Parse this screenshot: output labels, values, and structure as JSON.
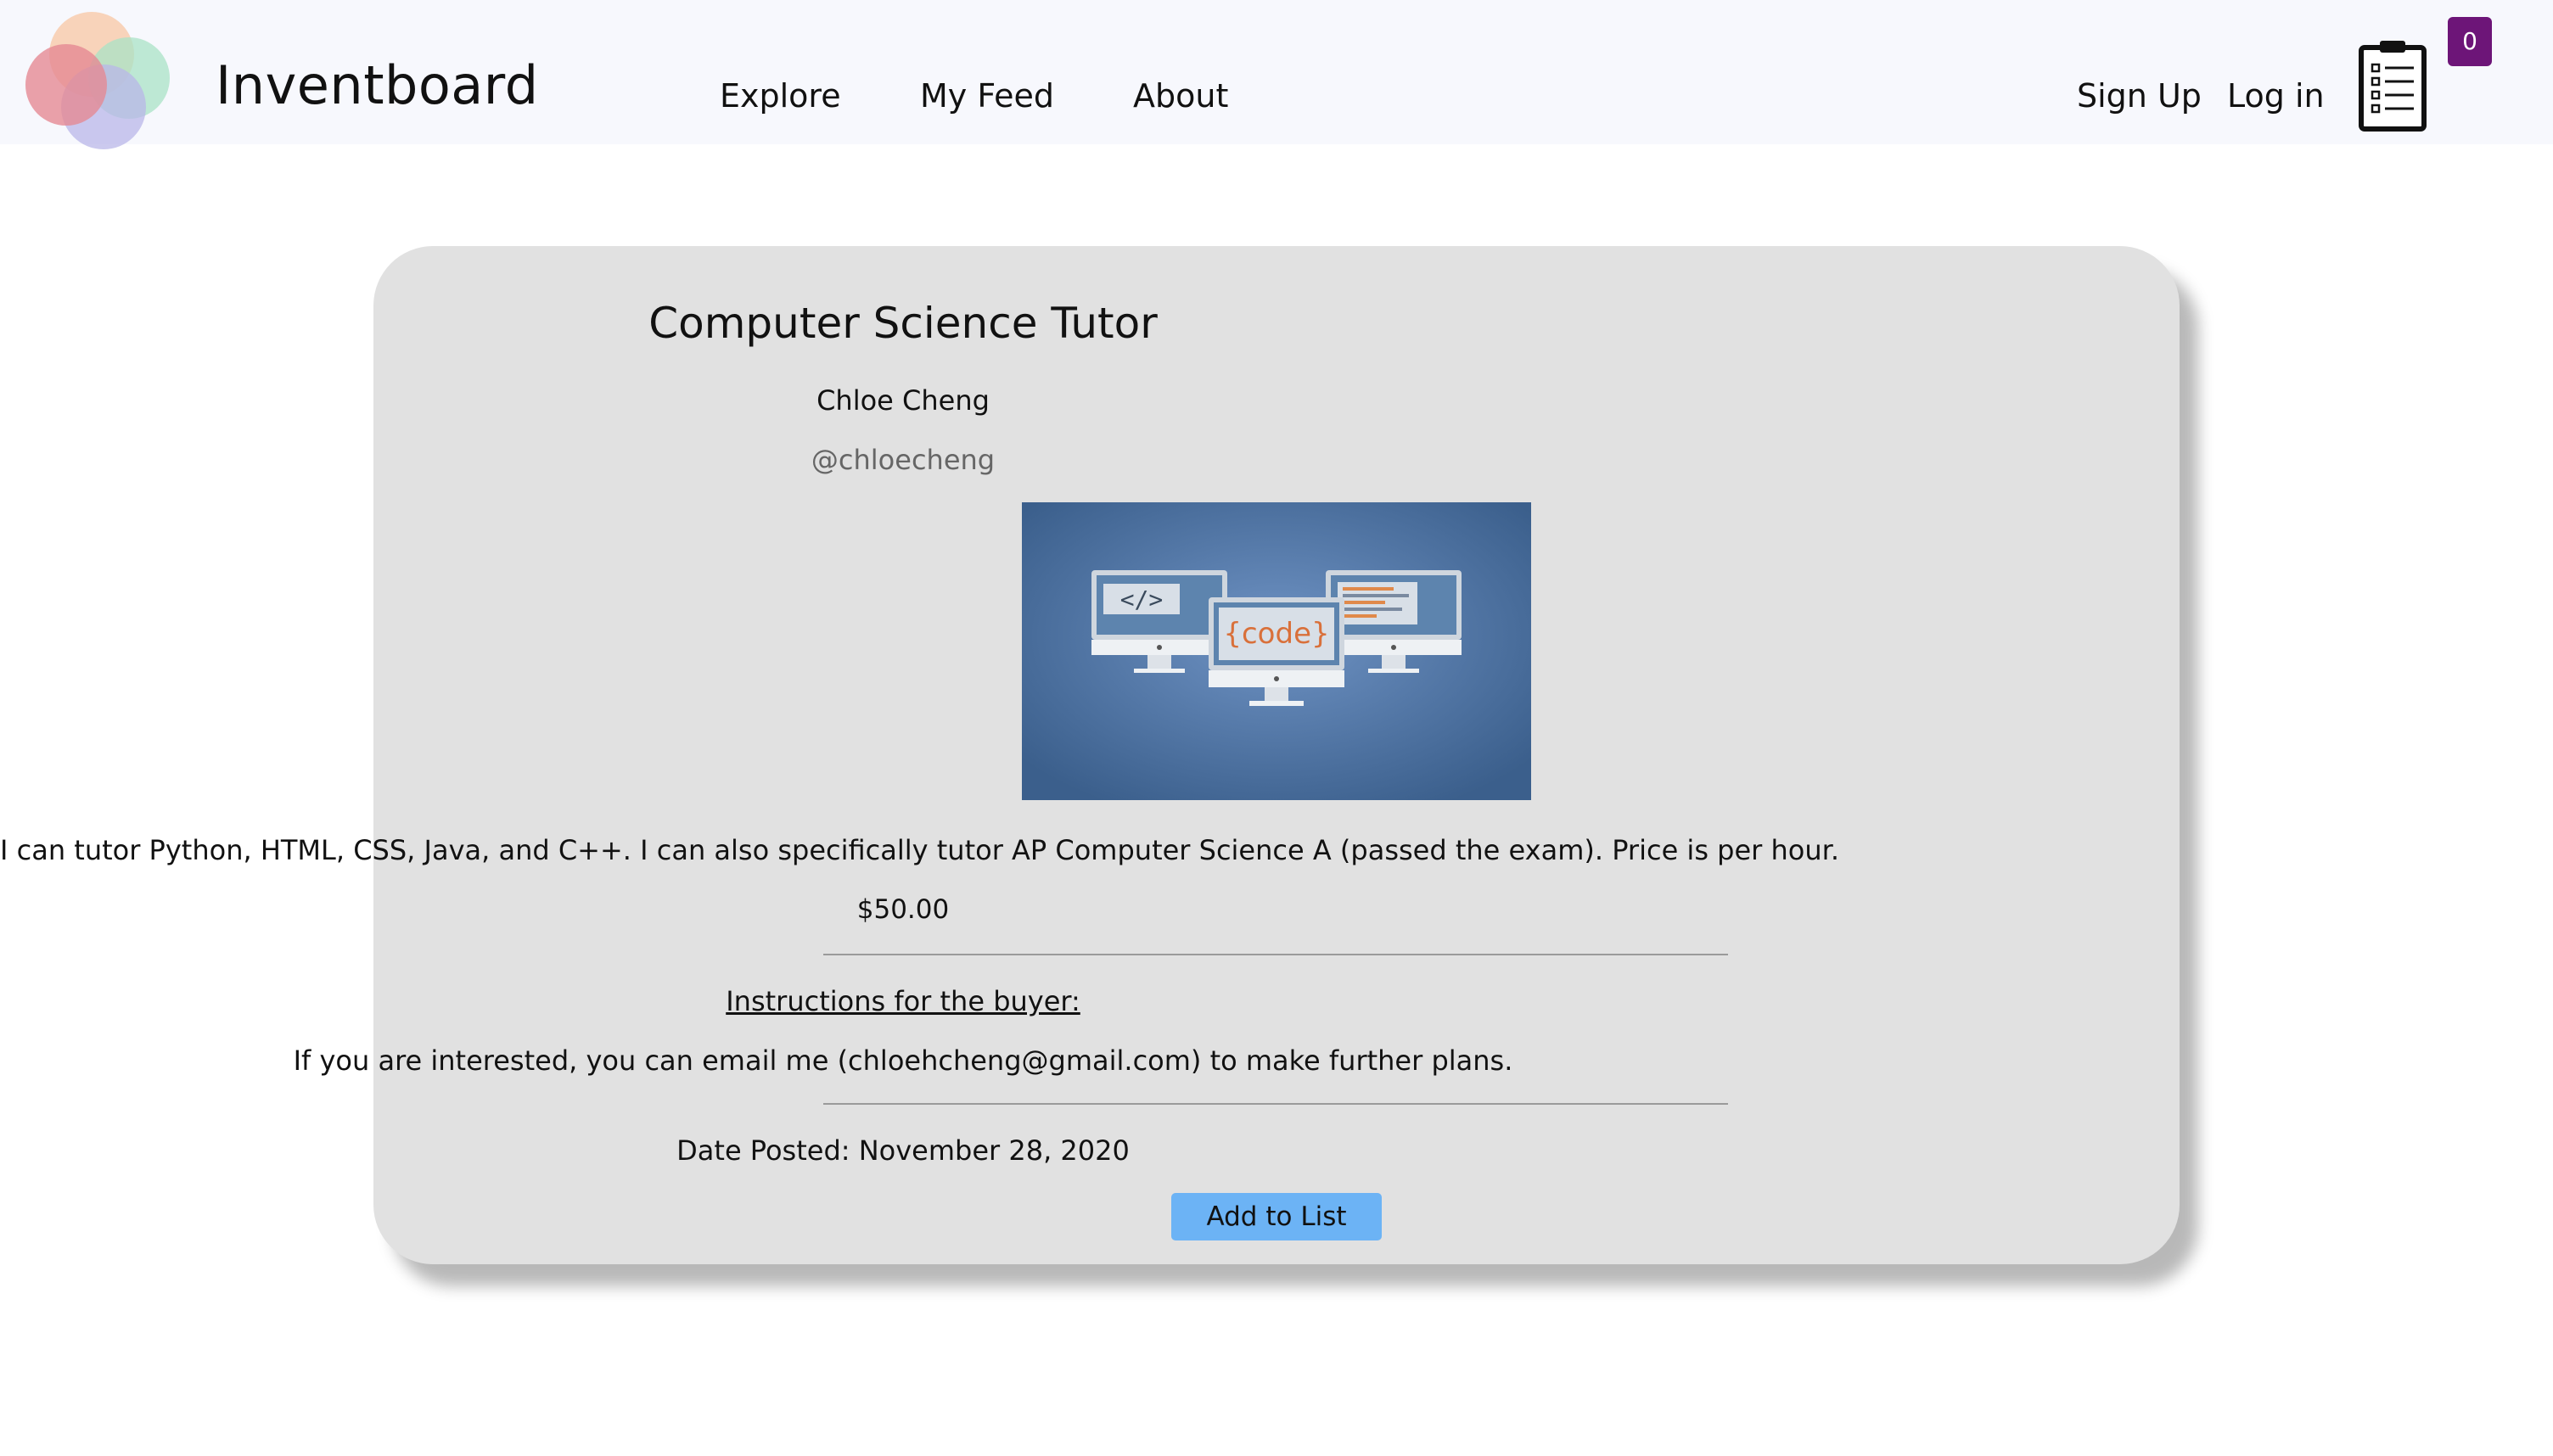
{
  "header": {
    "brand": "Inventboard",
    "nav": {
      "explore": "Explore",
      "my_feed": "My Feed",
      "about": "About",
      "sign_up": "Sign Up",
      "log_in": "Log in"
    },
    "cart_count": "0",
    "cart_icon": "clipboard-list-icon",
    "colors": {
      "navbar_bg": "#f7f8fd",
      "badge_bg": "#6d1578"
    }
  },
  "listing": {
    "title": "Computer Science Tutor",
    "seller_name": "Chloe Cheng",
    "seller_handle": "@chloecheng",
    "image": {
      "code_text": "{code}",
      "tag_text": "</>"
    },
    "description": "I can tutor Python, HTML, CSS, Java, and C++. I can also specifically tutor AP Computer Science A (passed the exam). Price is per hour.",
    "price": "$50.00",
    "instructions_label": "Instructions for the buyer:",
    "instructions": "If you are interested, you can email me (chloehcheng@gmail.com) to make further plans.",
    "date_posted": "Date Posted: November 28, 2020",
    "add_button": "Add to List",
    "colors": {
      "card_bg": "#e1e1e1",
      "button_bg": "#6cb3f5"
    }
  }
}
